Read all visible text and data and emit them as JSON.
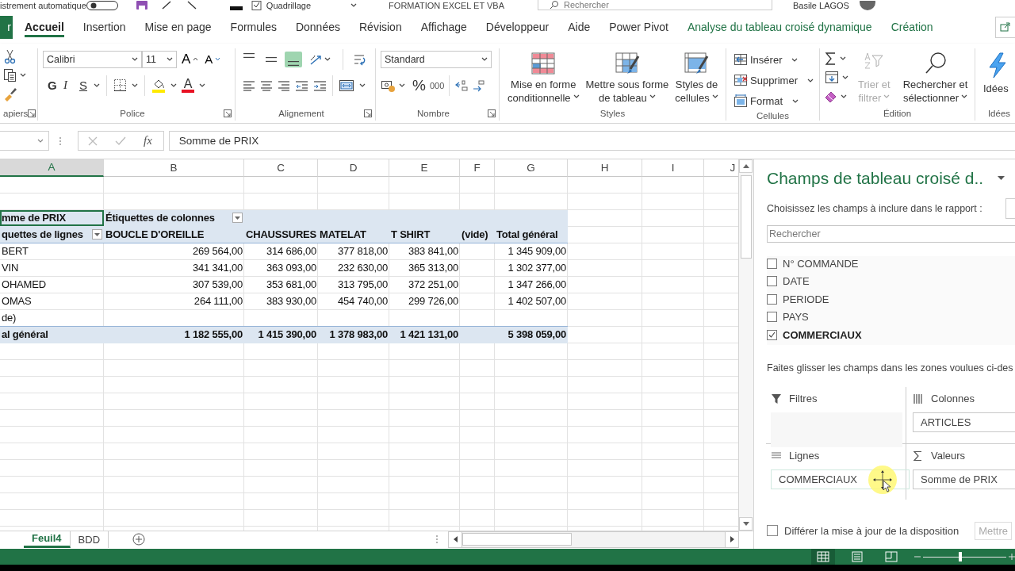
{
  "title_bar": {
    "autosave": "istrement automatique",
    "gridlines": "Quadrillage",
    "gridlines_checked": true,
    "document": "FORMATION EXCEL ET VBA",
    "search_placeholder": "Rechercher",
    "user": "Basile LAGOS"
  },
  "ribbon_tabs": [
    {
      "label": "r",
      "kind": "file",
      "selected": false
    },
    {
      "label": "Accueil",
      "kind": "tab",
      "selected": true
    },
    {
      "label": "Insertion",
      "kind": "tab",
      "selected": false
    },
    {
      "label": "Mise en page",
      "kind": "tab",
      "selected": false
    },
    {
      "label": "Formules",
      "kind": "tab",
      "selected": false
    },
    {
      "label": "Données",
      "kind": "tab",
      "selected": false
    },
    {
      "label": "Révision",
      "kind": "tab",
      "selected": false
    },
    {
      "label": "Affichage",
      "kind": "tab",
      "selected": false
    },
    {
      "label": "Développeur",
      "kind": "tab",
      "selected": false
    },
    {
      "label": "Aide",
      "kind": "tab",
      "selected": false
    },
    {
      "label": "Power Pivot",
      "kind": "tab",
      "selected": false
    },
    {
      "label": "Analyse du tableau croisé dynamique",
      "kind": "contextual",
      "selected": false
    },
    {
      "label": "Création",
      "kind": "contextual",
      "selected": false
    }
  ],
  "ribbon_groups": [
    {
      "kind": "clipboard",
      "label": "apiers"
    },
    {
      "kind": "font",
      "label": "Police",
      "font": "Calibri",
      "size": "11",
      "grow": "A",
      "shrink": "A",
      "bold": "G",
      "italic": "I",
      "underline": "S",
      "font_color": "A"
    },
    {
      "kind": "alignment",
      "label": "Alignement",
      "vertical": [
        {
          "selected": false
        },
        {
          "selected": false
        },
        {
          "selected": true
        }
      ]
    },
    {
      "kind": "number",
      "label": "Nombre",
      "format": "Standard",
      "percent": "%",
      "thousands": "000"
    },
    {
      "kind": "styles",
      "label": "Styles",
      "buttons": [
        {
          "lines": [
            "Mise en forme",
            "conditionnelle"
          ]
        },
        {
          "lines": [
            "Mettre sous forme",
            "de tableau"
          ]
        },
        {
          "lines": [
            "Styles de",
            "cellules"
          ]
        }
      ]
    },
    {
      "kind": "cells",
      "label": "Cellules",
      "buttons": [
        "Insérer",
        "Supprimer",
        "Format"
      ]
    },
    {
      "kind": "editing",
      "label": "Édition",
      "buttons": [
        {
          "lines": [
            "Trier et",
            "filtrer"
          ],
          "disabled": true
        },
        {
          "lines": [
            "Rechercher et",
            "sélectionner"
          ],
          "disabled": false
        }
      ]
    },
    {
      "kind": "ideas",
      "label": "Idées",
      "button": "Idées"
    }
  ],
  "formula_bar": {
    "function_label": "fx",
    "formula": "Somme de PRIX"
  },
  "sheet": {
    "columns": [
      {
        "label": "A",
        "selected": true
      },
      {
        "label": "B",
        "selected": false
      },
      {
        "label": "C",
        "selected": false
      },
      {
        "label": "D",
        "selected": false
      },
      {
        "label": "E",
        "selected": false
      },
      {
        "label": "F",
        "selected": false
      },
      {
        "label": "G",
        "selected": false
      },
      {
        "label": "H",
        "selected": false
      },
      {
        "label": "I",
        "selected": false
      },
      {
        "label": "J",
        "selected": false
      }
    ],
    "rows": [
      {
        "kind": "blank",
        "active": false
      },
      {
        "kind": "blank",
        "active": false
      },
      {
        "kind": "pivot_title",
        "active": true,
        "cells": [
          "mme de PRIX",
          "Étiquettes de colonnes"
        ]
      },
      {
        "kind": "pivot_header",
        "active": false,
        "cells": [
          "quettes de lignes",
          "BOUCLE D'OREILLE",
          "CHAUSSURES",
          "MATELAT",
          "T SHIRT",
          "(vide)",
          "Total général"
        ]
      },
      {
        "kind": "data",
        "active": false,
        "cells": [
          "BERT",
          "269 564,00",
          "314 686,00",
          "377 818,00",
          "383 841,00",
          null,
          "1 345 909,00"
        ]
      },
      {
        "kind": "data",
        "active": false,
        "cells": [
          "VIN",
          "341 341,00",
          "363 093,00",
          "232 630,00",
          "365 313,00",
          null,
          "1 302 377,00"
        ]
      },
      {
        "kind": "data",
        "active": false,
        "cells": [
          "OHAMED",
          "307 539,00",
          "353 681,00",
          "313 795,00",
          "372 251,00",
          null,
          "1 347 266,00"
        ]
      },
      {
        "kind": "data",
        "active": false,
        "cells": [
          "OMAS",
          "264 111,00",
          "383 930,00",
          "454 740,00",
          "299 726,00",
          null,
          "1 402 507,00"
        ]
      },
      {
        "kind": "data",
        "active": false,
        "cells": [
          "de)"
        ]
      },
      {
        "kind": "total",
        "active": false,
        "cells": [
          "al général",
          "1 182 555,00",
          "1 415 390,00",
          "1 378 983,00",
          "1 421 131,00",
          null,
          "5 398 059,00"
        ]
      }
    ]
  },
  "sheet_tabs": [
    {
      "label": "Feuil4",
      "selected": true
    },
    {
      "label": "BDD",
      "selected": false
    }
  ],
  "pivot_pane": {
    "title": "Champs de tableau croisé d..",
    "instruction": "Choisissez les champs à inclure dans le rapport :",
    "search_placeholder": "Rechercher",
    "fields": [
      {
        "label": "N° COMMANDE",
        "checked": false
      },
      {
        "label": "DATE",
        "checked": false
      },
      {
        "label": "PERIODE",
        "checked": false
      },
      {
        "label": "PAYS",
        "checked": false
      },
      {
        "label": "COMMERCIAUX",
        "checked": true
      }
    ],
    "drag_hint": "Faites glisser les champs dans les zones voulues ci-des",
    "areas": [
      {
        "kind": "filters",
        "label": "Filtres"
      },
      {
        "kind": "columns",
        "label": "Colonnes",
        "items": [
          "ARTICLES"
        ]
      },
      {
        "kind": "rows",
        "label": "Lignes",
        "items": [
          "COMMERCIAUX"
        ]
      },
      {
        "kind": "values",
        "label": "Valeurs",
        "items": [
          "Somme de PRIX"
        ]
      }
    ],
    "defer": {
      "label": "Différer la mise à jour de la disposition",
      "checked": false
    },
    "update_button": "Mettre"
  },
  "status_bar": {
    "views": [
      {
        "selected": true
      },
      {
        "selected": false
      },
      {
        "selected": false
      }
    ],
    "zoom": {
      "level": 0.45
    }
  }
}
